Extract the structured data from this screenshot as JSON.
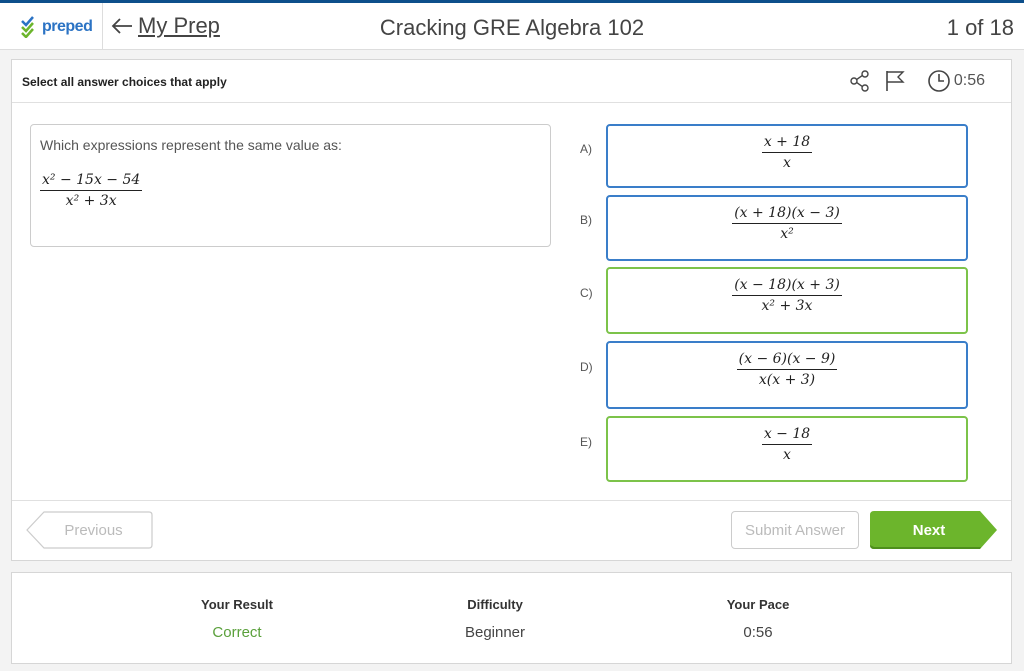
{
  "header": {
    "logo_text": "preped",
    "back_label": "My Prep",
    "title": "Cracking GRE Algebra 102",
    "counter": "1 of 18"
  },
  "question_panel": {
    "instruction": "Select all answer choices that apply",
    "timer": "0:56",
    "prompt": "Which expressions represent the same value as:",
    "expression": {
      "num": "x² − 15x − 54",
      "den": "x² + 3x"
    }
  },
  "choices": [
    {
      "letter": "A)",
      "num": "x + 18",
      "den": "x",
      "state": "default"
    },
    {
      "letter": "B)",
      "num": "(x + 18)(x − 3)",
      "den": "x²",
      "state": "default"
    },
    {
      "letter": "C)",
      "num": "(x − 18)(x + 3)",
      "den": "x² + 3x",
      "state": "correct"
    },
    {
      "letter": "D)",
      "num": "(x − 6)(x − 9)",
      "den": "x(x + 3)",
      "state": "default"
    },
    {
      "letter": "E)",
      "num": "x − 18",
      "den": "x",
      "state": "correct"
    }
  ],
  "footer": {
    "previous": "Previous",
    "submit": "Submit Answer",
    "next": "Next"
  },
  "result": {
    "your_result_label": "Your Result",
    "your_result_value": "Correct",
    "difficulty_label": "Difficulty",
    "difficulty_value": "Beginner",
    "pace_label": "Your Pace",
    "pace_value": "0:56"
  },
  "colors": {
    "brand_blue": "#0d4f8b",
    "choice_border": "#3a7ec9",
    "correct_green": "#7cc34a",
    "next_green": "#6cb52c"
  },
  "icons": [
    "checkmark-logo-icon",
    "arrow-left-icon",
    "share-icon",
    "flag-icon",
    "clock-icon"
  ]
}
